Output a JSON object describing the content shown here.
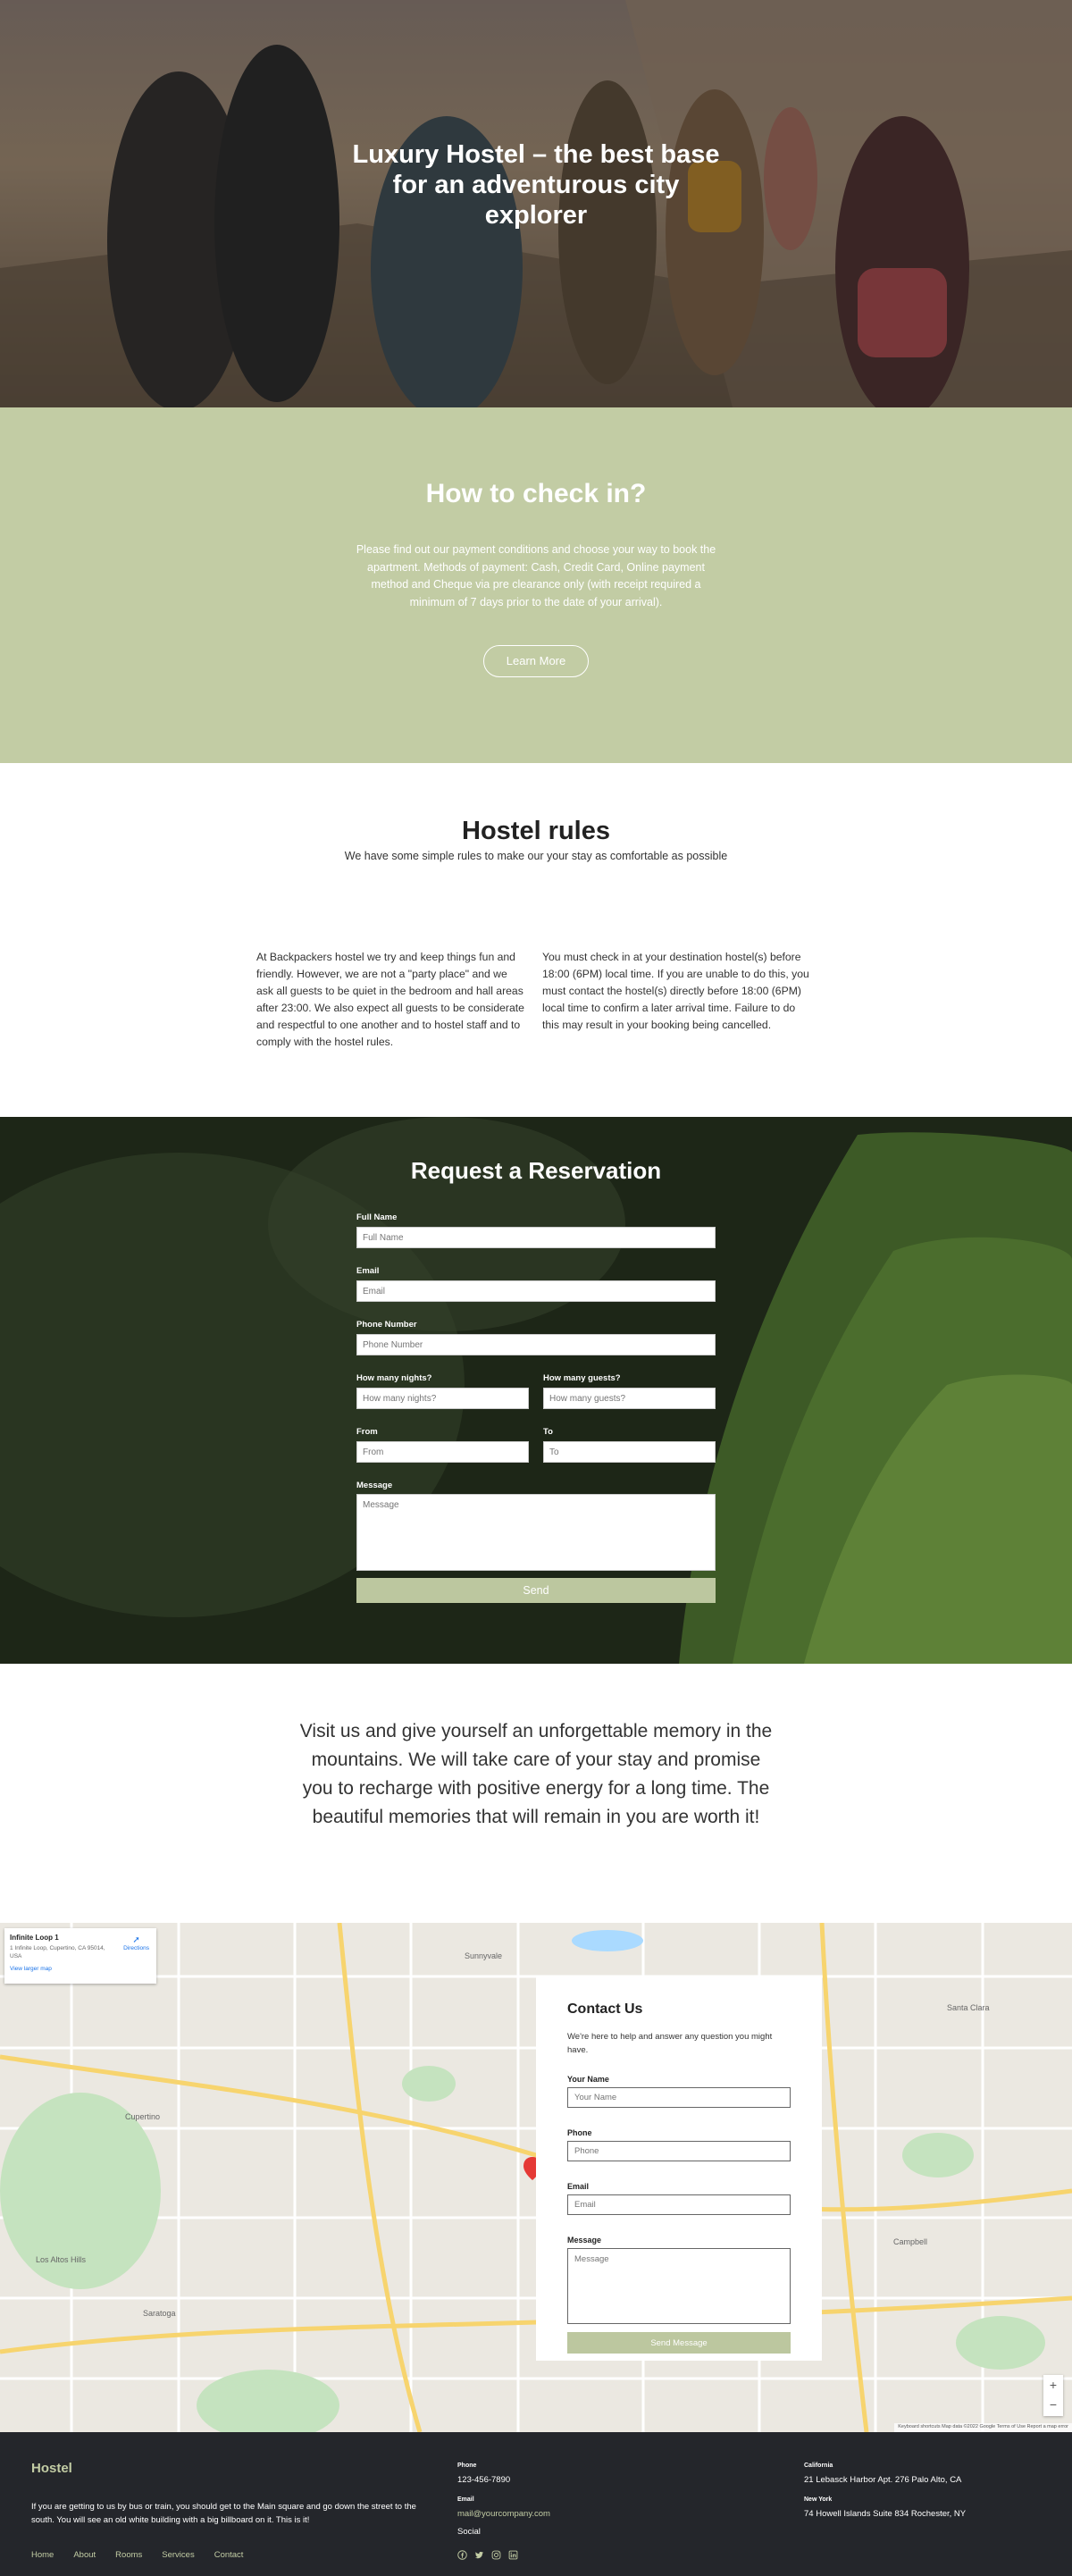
{
  "hero": {
    "title": "Luxury Hostel – the best base for an adventurous city explorer"
  },
  "checkin": {
    "title": "How to check in?",
    "text": "Please find out our payment conditions and choose your way to book the apartment. Methods of payment: Cash, Credit Card, Online payment method and Cheque via pre clearance only (with receipt required a minimum of 7 days prior to the date of your arrival).",
    "button": "Learn More"
  },
  "rules": {
    "title": "Hostel rules",
    "subtitle": "We have some simple rules to make our your stay as comfortable as possible",
    "col_left": "At Backpackers hostel we try and keep things fun and friendly. However, we are not a \"party place\" and we ask all guests to be quiet in the bedroom and hall areas after 23:00. We also expect all guests to be considerate and respectful to one another and to hostel staff and to comply with the hostel rules.",
    "col_right": "You must check in at your destination hostel(s) before 18:00 (6PM) local time. If you are unable to do this, you must contact the hostel(s) directly before 18:00 (6PM) local time to confirm a later arrival time. Failure to do this may result in your booking being cancelled."
  },
  "reservation": {
    "title": "Request a Reservation",
    "full_name_label": "Full Name",
    "full_name_placeholder": "Full Name",
    "email_label": "Email",
    "email_placeholder": "Email",
    "phone_label": "Phone Number",
    "phone_placeholder": "Phone Number",
    "nights_label": "How many nights?",
    "nights_placeholder": "How many nights?",
    "guests_label": "How many guests?",
    "guests_placeholder": "How many guests?",
    "from_label": "From",
    "from_placeholder": "From",
    "to_label": "To",
    "to_placeholder": "To",
    "message_label": "Message",
    "message_placeholder": "Message",
    "send": "Send"
  },
  "quote": {
    "text": "Visit us and give yourself an unforgettable memory in the mountains. We will take care of your stay and promise you to recharge with positive energy for a long time. The beautiful memories that will remain in you are worth it!"
  },
  "map": {
    "place_title": "Infinite Loop 1",
    "place_address": "1 Infinite Loop, Cupertino, CA 95014, USA",
    "directions": "Directions",
    "larger_map": "View larger map",
    "attribution": "Keyboard shortcuts   Map data ©2022 Google   Terms of Use   Report a map error",
    "labels": [
      "Santa Clara",
      "Cupertino",
      "Sunnyvale",
      "Los Altos Hills",
      "Saratoga",
      "Campbell"
    ]
  },
  "contact": {
    "title": "Contact Us",
    "intro": "We're here to help and answer any question you might have.",
    "name_label": "Your Name",
    "name_placeholder": "Your Name",
    "phone_label": "Phone",
    "phone_placeholder": "Phone",
    "email_label": "Email",
    "email_placeholder": "Email",
    "message_label": "Message",
    "message_placeholder": "Message",
    "send": "Send Message"
  },
  "footer": {
    "brand": "Hostel",
    "desc": "If you are getting to us by bus or train, you should get to the Main square and go down the street to the south. You will see an old white building with a big billboard on it. This is it!",
    "nav": [
      "Home",
      "About",
      "Rooms",
      "Services",
      "Contact"
    ],
    "phone_label": "Phone",
    "phone": "123-456-7890",
    "email_label": "Email",
    "email": "mail@yourcompany.com",
    "social_label": "Social",
    "ca_label": "California",
    "ca_address": "21 Lebasck Harbor Apt. 276 Palo Alto, CA",
    "ny_label": "New York",
    "ny_address": "74 Howell Islands Suite 834 Rochester, NY"
  },
  "colors": {
    "accent": "#c2cca4",
    "footer_bg": "#24262b",
    "button": "#bcc79f"
  }
}
